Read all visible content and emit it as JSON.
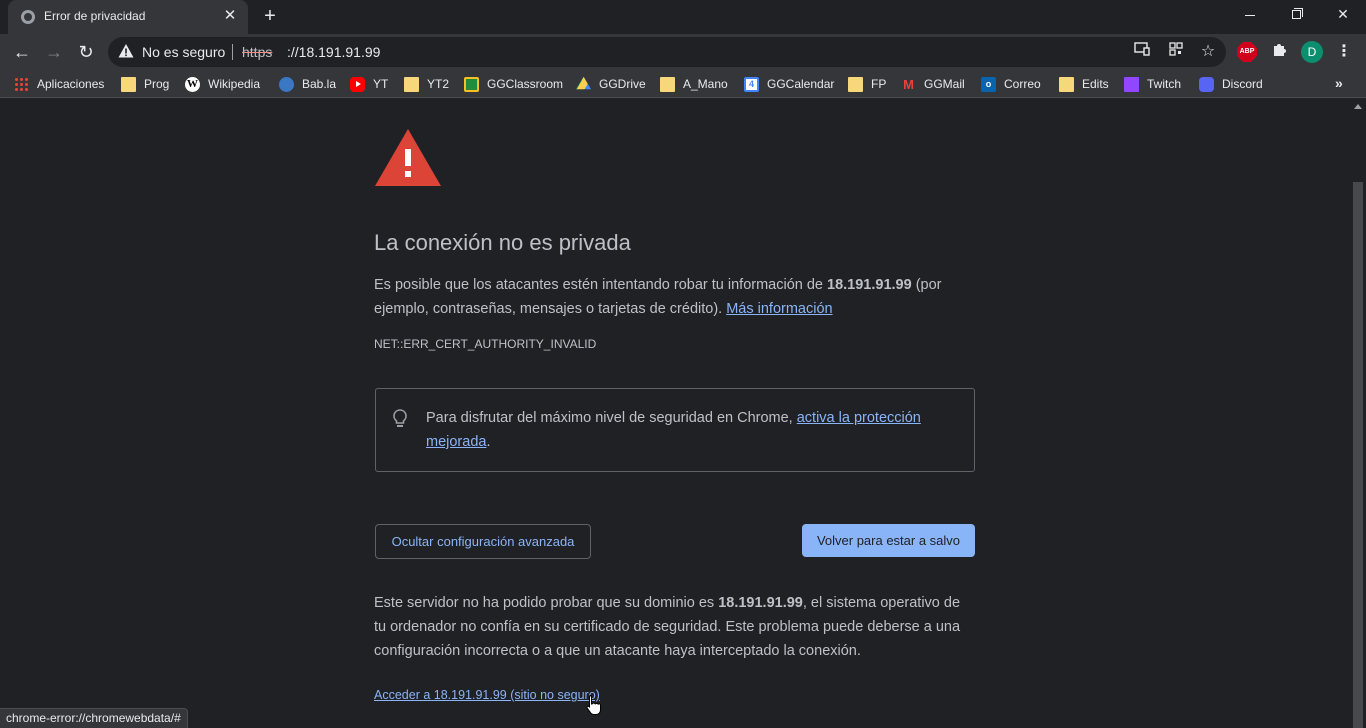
{
  "tab": {
    "title": "Error de privacidad",
    "close": "✕",
    "new_tab": "+"
  },
  "window": {
    "minimize": "",
    "maximize": "",
    "close": "✕"
  },
  "toolbar": {
    "back": "←",
    "forward": "→",
    "reload": "↻",
    "security_label": "No es seguro",
    "url_scheme": "https",
    "url_rest": "://18.191.91.99",
    "bookmark_star": "☆",
    "abp_label": "ABP",
    "profile_initial": "D",
    "menu": "⋮"
  },
  "bookmarks": [
    {
      "label": "Aplicaciones",
      "icon": "apps-icon"
    },
    {
      "label": "Prog",
      "icon": "folder-icon"
    },
    {
      "label": "Wikipedia",
      "icon": "wikipedia-icon"
    },
    {
      "label": "Bab.la",
      "icon": "babla-icon"
    },
    {
      "label": "YT",
      "icon": "youtube-icon"
    },
    {
      "label": "YT2",
      "icon": "folder-icon"
    },
    {
      "label": "GGClassroom",
      "icon": "classroom-icon"
    },
    {
      "label": "GGDrive",
      "icon": "drive-icon"
    },
    {
      "label": "A_Mano",
      "icon": "folder-icon"
    },
    {
      "label": "GGCalendar",
      "icon": "calendar-icon"
    },
    {
      "label": "FP",
      "icon": "folder-icon"
    },
    {
      "label": "GGMail",
      "icon": "gmail-icon"
    },
    {
      "label": "Correo",
      "icon": "outlook-icon"
    },
    {
      "label": "Edits",
      "icon": "folder-icon"
    },
    {
      "label": "Twitch",
      "icon": "twitch-icon"
    },
    {
      "label": "Discord",
      "icon": "discord-icon"
    }
  ],
  "bookmarks_more": "»",
  "colors": {
    "accent": "#8ab4f8",
    "danger": "#db4437",
    "background": "#202124"
  },
  "interstitial": {
    "heading": "La conexión no es privada",
    "intro_part1": "Es posible que los atacantes estén intentando robar tu información de ",
    "host": "18.191.91.99",
    "intro_part2": " (por ejemplo, contraseñas, mensajes o tarjetas de crédito). ",
    "learn_more": "Más información",
    "error_code": "NET::ERR_CERT_AUTHORITY_INVALID",
    "tip_text": "Para disfrutar del máximo nivel de seguridad en Chrome, ",
    "tip_link": "activa la protección mejorada",
    "tip_end": ".",
    "advanced_button": "Ocultar configuración avanzada",
    "safe_button": "Volver para estar a salvo",
    "details_part1": "Este servidor no ha podido probar que su dominio es ",
    "details_part2": ", el sistema operativo de tu ordenador no confía en su certificado de seguridad. Este problema puede deberse a una configuración incorrecta o a que un atacante haya interceptado la conexión.",
    "proceed_link": "Acceder a 18.191.91.99 (sitio no seguro)"
  },
  "status_bar": "chrome-error://chromewebdata/#"
}
